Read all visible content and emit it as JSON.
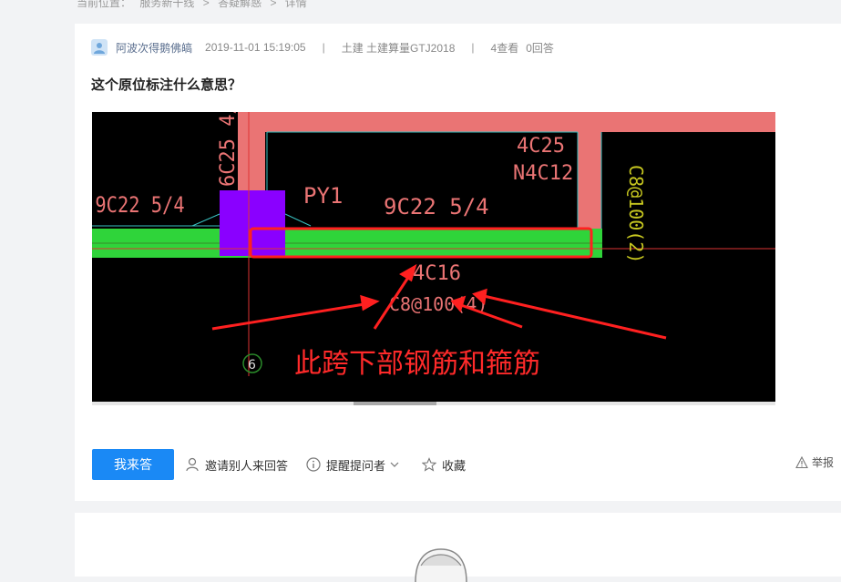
{
  "breadcrumb": {
    "label": "当前位置：",
    "items": [
      "服务新干线",
      ">",
      "答疑解惑",
      ">",
      "详情"
    ]
  },
  "question": {
    "author": "阿波次得鹅佛皜",
    "datetime": "2019-11-01 15:19:05",
    "divider": "|",
    "category": "土建 土建算量GTJ2018",
    "views": "4查看",
    "answers": "0回答",
    "title": "这个原位标注什么意思？"
  },
  "attachment": {
    "labels": {
      "left_rebar": "9C22 5/4",
      "vertical_rebar": "6C25 4/",
      "beam_name": "PY1",
      "middle_rebar": "9C22 5/4",
      "top_rebar1": "4C25",
      "top_rebar2": "N4C12",
      "right_stirrup": "C8@100(2)",
      "bottom_rebar": "4C16",
      "stirrup": "C8@100(4)",
      "axis_number": "6",
      "annotation": "此跨下部钢筋和箍筋"
    }
  },
  "actions": {
    "answer_button": "我来答",
    "invite": "邀请别人来回答",
    "remind": "提醒提问者",
    "favorite": "收藏",
    "report": "举报"
  },
  "colors": {
    "accent": "#1a89f5",
    "annotation_red": "#ff2a2a",
    "beam_green": "#2fd43a",
    "column_purple": "#8a00ff",
    "wall_pink": "#ea7474"
  }
}
